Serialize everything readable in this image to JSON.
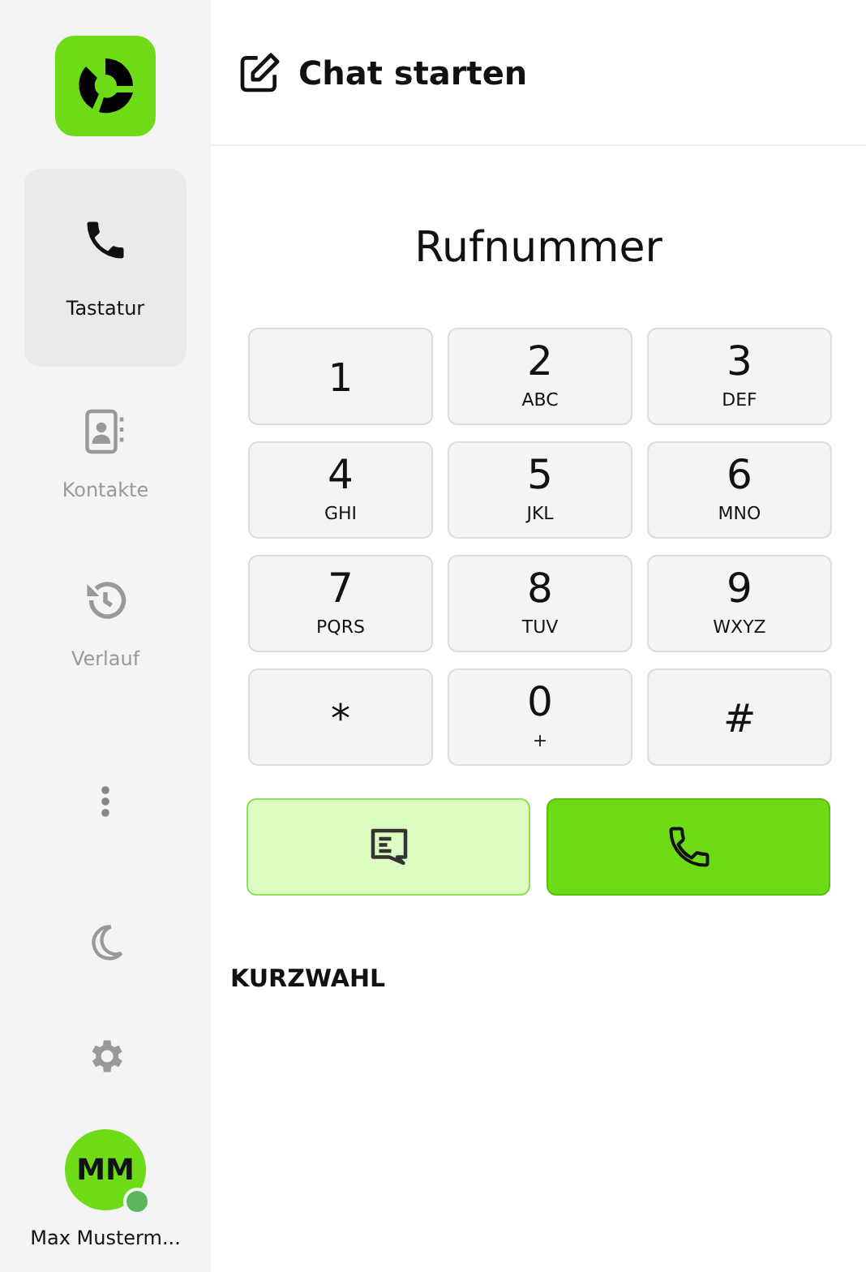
{
  "sidebar": {
    "nav": [
      {
        "kind": "phone",
        "label": "Tastatur",
        "selected": true
      },
      {
        "kind": "contacts",
        "label": "Kontakte",
        "selected": false
      },
      {
        "kind": "history",
        "label": "Verlauf",
        "selected": false
      }
    ],
    "user": {
      "initials": "MM",
      "name": "Max Musterm...",
      "online": true
    }
  },
  "header": {
    "title": "Chat starten"
  },
  "dialer": {
    "title": "Rufnummer",
    "keys": [
      {
        "digit": "1"
      },
      {
        "digit": "2",
        "letters": "ABC"
      },
      {
        "digit": "3",
        "letters": "DEF"
      },
      {
        "digit": "4",
        "letters": "GHI"
      },
      {
        "digit": "5",
        "letters": "JKL"
      },
      {
        "digit": "6",
        "letters": "MNO"
      },
      {
        "digit": "7",
        "letters": "PQRS"
      },
      {
        "digit": "8",
        "letters": "TUV"
      },
      {
        "digit": "9",
        "letters": "WXYZ"
      },
      {
        "digit": "*"
      },
      {
        "digit": "0",
        "letters": "+"
      },
      {
        "digit": "#"
      }
    ]
  },
  "speed_dial": {
    "title": "KURZWAHL"
  }
}
